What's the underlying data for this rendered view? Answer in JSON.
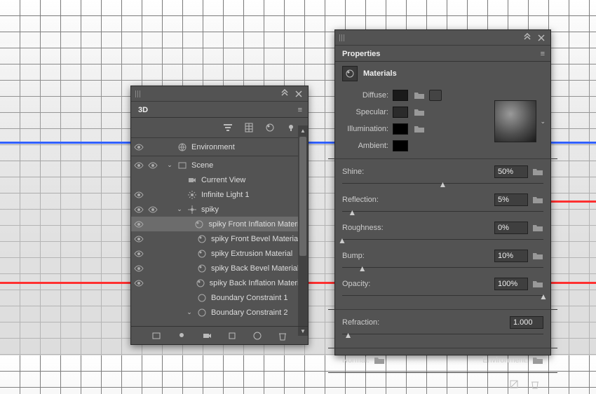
{
  "panel3d": {
    "title": "3D",
    "tree": [
      {
        "depth": 0,
        "eye": true,
        "caret": "",
        "icon": "globe",
        "label": "Environment"
      },
      {
        "depth": 0,
        "eye": true,
        "caret": "⌄",
        "icon": "scene",
        "label": "Scene"
      },
      {
        "depth": 1,
        "eye": false,
        "caret": "",
        "icon": "camera",
        "label": "Current View"
      },
      {
        "depth": 1,
        "eye": true,
        "caret": "",
        "icon": "light",
        "label": "Infinite Light 1"
      },
      {
        "depth": 1,
        "eye": true,
        "caret": "⌄",
        "icon": "mesh",
        "label": "spiky"
      },
      {
        "depth": 2,
        "eye": true,
        "caret": "",
        "icon": "mat",
        "label": "spiky Front Inflation Material",
        "sel": true
      },
      {
        "depth": 2,
        "eye": true,
        "caret": "",
        "icon": "mat",
        "label": "spiky Front Bevel Material"
      },
      {
        "depth": 2,
        "eye": true,
        "caret": "",
        "icon": "mat",
        "label": "spiky Extrusion Material"
      },
      {
        "depth": 2,
        "eye": true,
        "caret": "",
        "icon": "mat",
        "label": "spiky Back Bevel Material"
      },
      {
        "depth": 2,
        "eye": true,
        "caret": "",
        "icon": "mat",
        "label": "spiky Back Inflation Material"
      },
      {
        "depth": 2,
        "eye": false,
        "caret": "",
        "icon": "bound",
        "label": "Boundary Constraint 1"
      },
      {
        "depth": 2,
        "eye": false,
        "caret": "⌄",
        "icon": "bound",
        "label": "Boundary Constraint 2"
      }
    ]
  },
  "props": {
    "title": "Properties",
    "section": "Materials",
    "rows": {
      "diffuse": "Diffuse:",
      "specular": "Specular:",
      "illumination": "Illumination:",
      "ambient": "Ambient:"
    },
    "sliders": [
      {
        "label": "Shine:",
        "value": "50%",
        "pos": 50,
        "folder": true
      },
      {
        "label": "Reflection:",
        "value": "5%",
        "pos": 5,
        "folder": true
      },
      {
        "label": "Roughness:",
        "value": "0%",
        "pos": 0,
        "folder": true
      },
      {
        "label": "Bump:",
        "value": "10%",
        "pos": 10,
        "folder": true
      },
      {
        "label": "Opacity:",
        "value": "100%",
        "pos": 100,
        "folder": true
      }
    ],
    "refraction": {
      "label": "Refraction:",
      "value": "1.000"
    },
    "normal": "Normal:",
    "environment": "Environment:"
  }
}
